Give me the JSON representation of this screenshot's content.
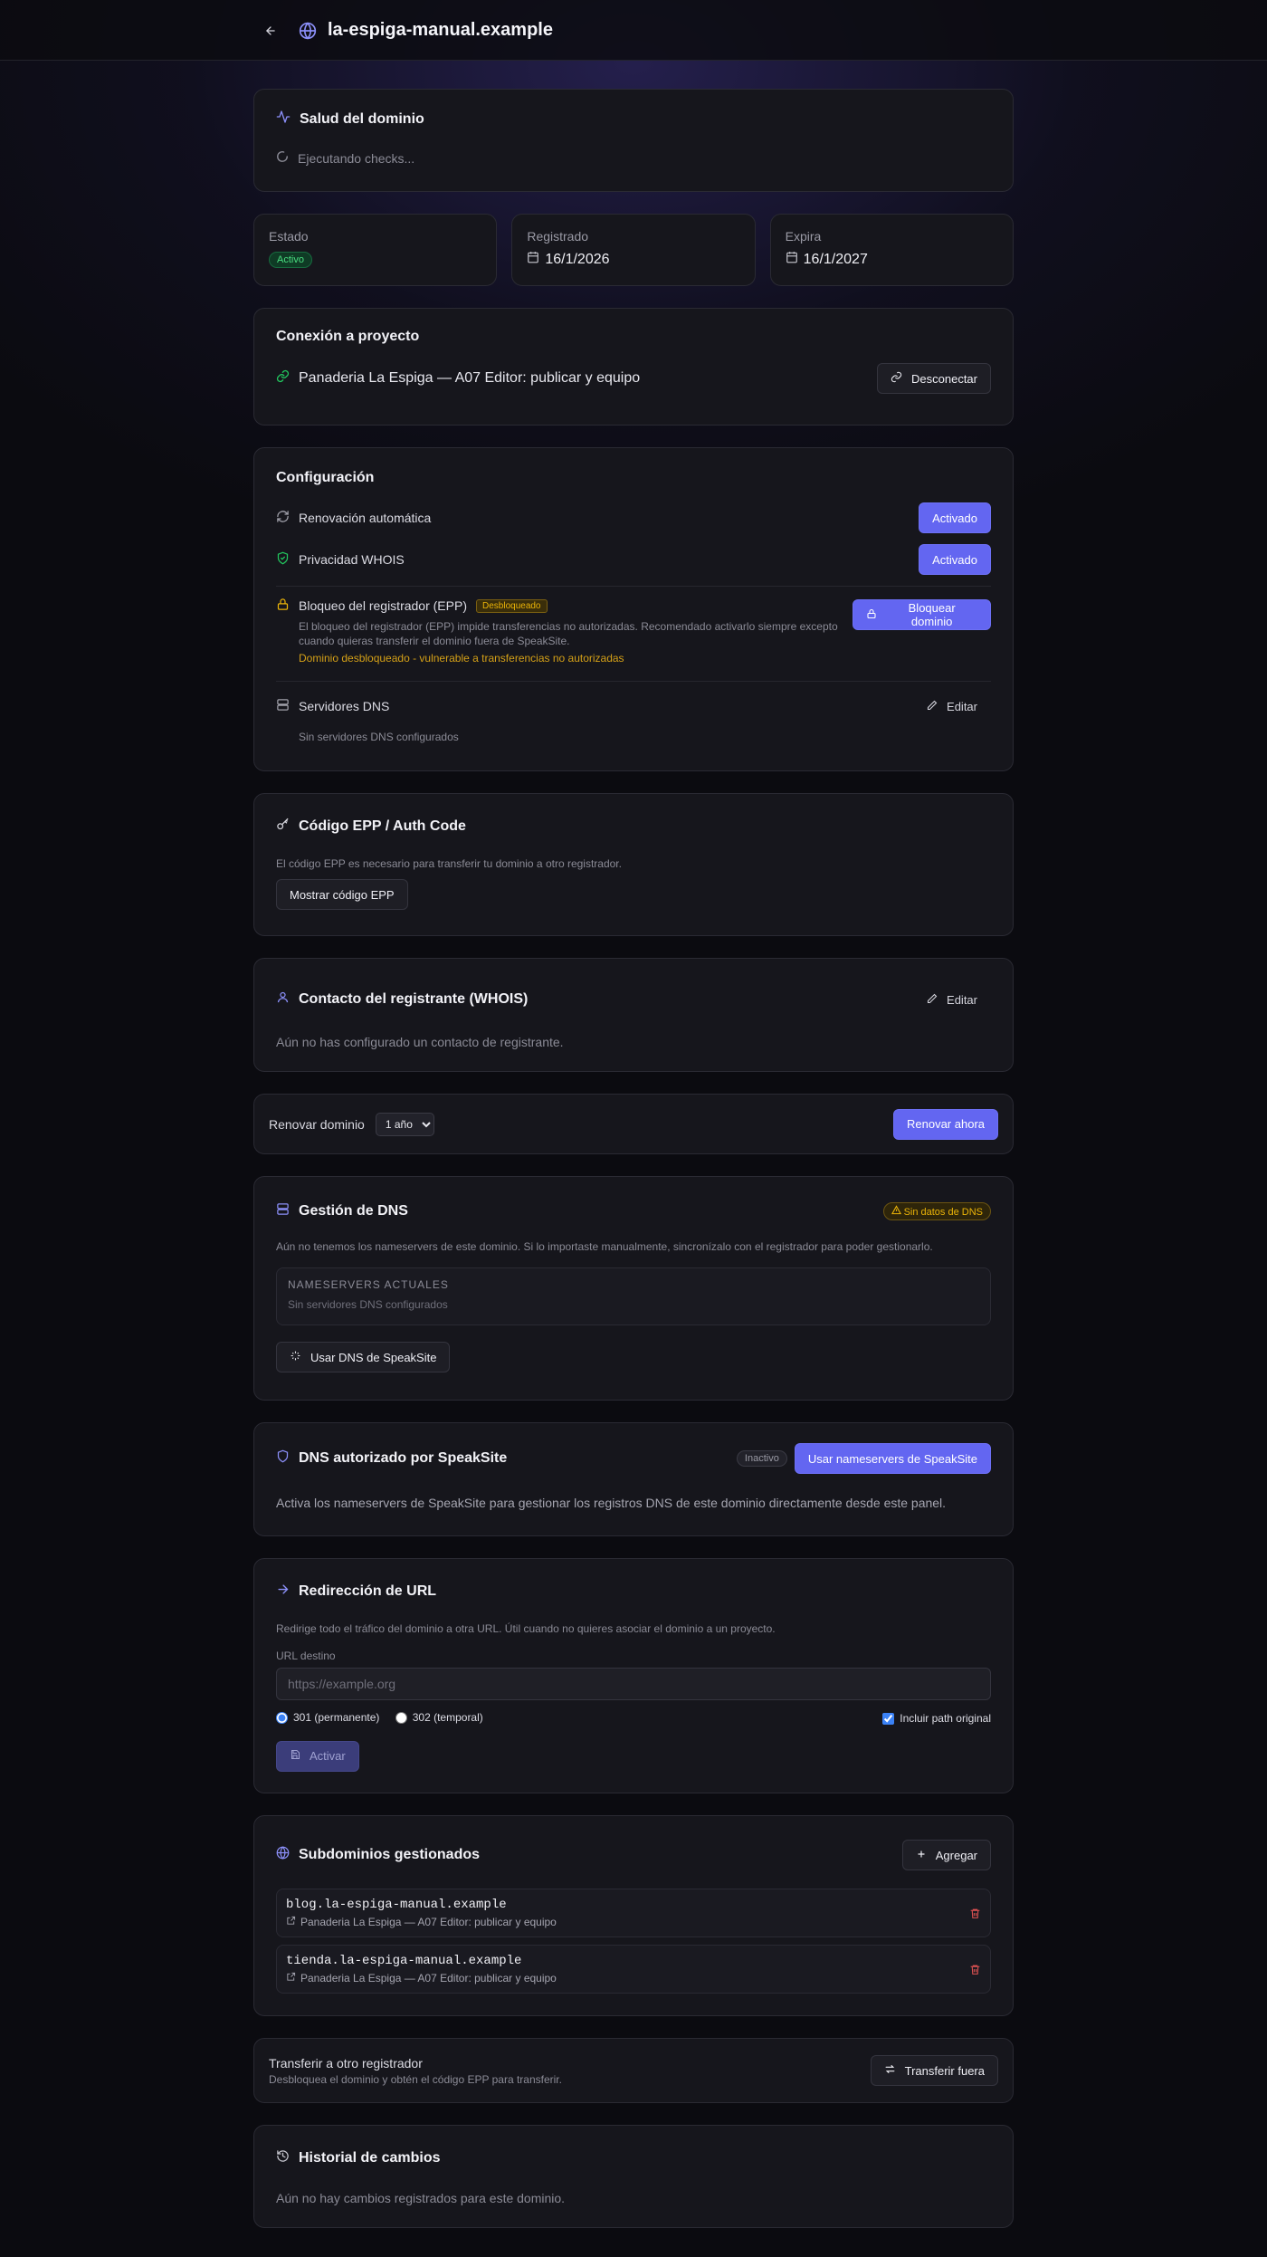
{
  "header": {
    "domain": "la-espiga-manual.example"
  },
  "health": {
    "title": "Salud del dominio",
    "status": "Ejecutando checks..."
  },
  "stats": {
    "estado_label": "Estado",
    "estado_value": "Activo",
    "registrado_label": "Registrado",
    "registrado_value": "16/1/2026",
    "expira_label": "Expira",
    "expira_value": "16/1/2027"
  },
  "connection": {
    "title": "Conexión a proyecto",
    "project": "Panaderia La Espiga — A07 Editor: publicar y equipo",
    "disconnect_label": "Desconectar"
  },
  "config": {
    "title": "Configuración",
    "auto_renew_label": "Renovación automática",
    "auto_renew_value": "Activado",
    "whois_label": "Privacidad WHOIS",
    "whois_value": "Activado",
    "lock_label": "Bloqueo del registrador (EPP)",
    "lock_badge": "Desbloqueado",
    "lock_desc": "El bloqueo del registrador (EPP) impide transferencias no autorizadas. Recomendado activarlo siempre excepto cuando quieras transferir el dominio fuera de SpeakSite.",
    "lock_warning": "Dominio desbloqueado - vulnerable a transferencias no autorizadas",
    "lock_button": "Bloquear dominio",
    "dns_label": "Servidores DNS",
    "dns_edit": "Editar",
    "dns_empty": "Sin servidores DNS configurados"
  },
  "epp": {
    "title": "Código EPP / Auth Code",
    "desc": "El código EPP es necesario para transferir tu dominio a otro registrador.",
    "button": "Mostrar código EPP"
  },
  "contact": {
    "title": "Contacto del registrante (WHOIS)",
    "edit": "Editar",
    "empty": "Aún no has configurado un contacto de registrante."
  },
  "renew": {
    "label": "Renovar dominio",
    "selected": "1 año",
    "button": "Renovar ahora"
  },
  "dns_mgmt": {
    "title": "Gestión de DNS",
    "badge": "Sin datos de DNS",
    "desc": "Aún no tenemos los nameservers de este dominio. Si lo importaste manualmente, sincronízalo con el registrador para poder gestionarlo.",
    "ns_heading": "NAMESERVERS ACTUALES",
    "ns_empty": "Sin servidores DNS configurados",
    "button": "Usar DNS de SpeakSite"
  },
  "auth_dns": {
    "title": "DNS autorizado por SpeakSite",
    "badge": "Inactivo",
    "button": "Usar nameservers de SpeakSite",
    "desc": "Activa los nameservers de SpeakSite para gestionar los registros DNS de este dominio directamente desde este panel."
  },
  "redirect": {
    "title": "Redirección de URL",
    "desc": "Redirige todo el tráfico del dominio a otra URL. Útil cuando no quieres asociar el dominio a un proyecto.",
    "url_label": "URL destino",
    "url_placeholder": "https://example.org",
    "opt_301": "301 (permanente)",
    "opt_302": "302 (temporal)",
    "include_path": "Incluir path original",
    "button": "Activar"
  },
  "subdomains": {
    "title": "Subdominios gestionados",
    "add": "Agregar",
    "items": [
      {
        "name": "blog.la-espiga-manual.example",
        "project": "Panaderia La Espiga — A07 Editor: publicar y equipo"
      },
      {
        "name": "tienda.la-espiga-manual.example",
        "project": "Panaderia La Espiga — A07 Editor: publicar y equipo"
      }
    ]
  },
  "transfer": {
    "title": "Transferir a otro registrador",
    "desc": "Desbloquea el dominio y obtén el código EPP para transferir.",
    "button": "Transferir fuera"
  },
  "history": {
    "title": "Historial de cambios",
    "empty": "Aún no hay cambios registrados para este dominio."
  },
  "colors": {
    "accent": "#6366f1",
    "success": "#22c55e",
    "warning": "#eab308",
    "danger": "#e05252"
  }
}
